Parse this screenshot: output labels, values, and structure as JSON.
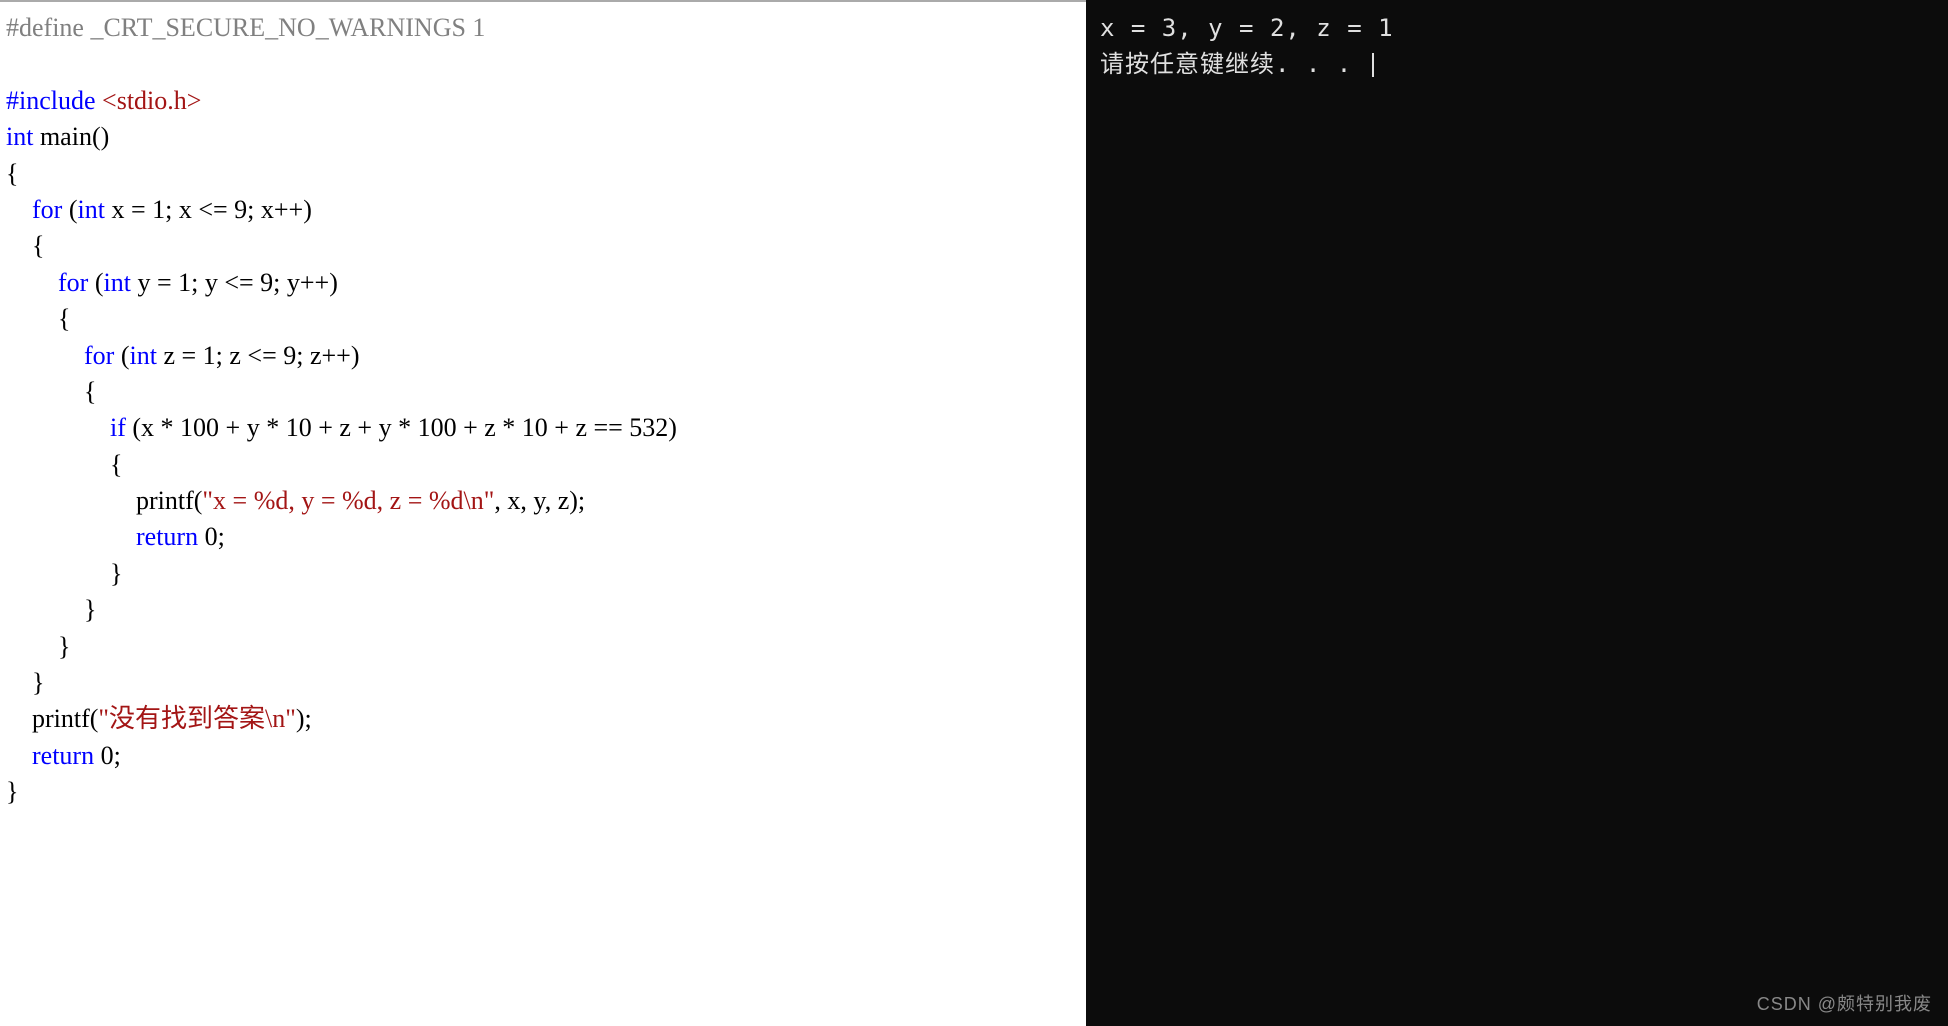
{
  "code": {
    "line1_define": "#define",
    "line1_macro": " _CRT_SECURE_NO_WARNINGS 1",
    "line3_include": "#include",
    "line3_header": " <stdio.h>",
    "line4_type": "int",
    "line4_main": " main()",
    "line5_brace": "{",
    "line6_indent": "    ",
    "line6_for": "for",
    "line6_rest1": " (",
    "line6_int": "int",
    "line6_rest2": " x = 1; x <= 9; x++)",
    "line7": "    {",
    "line8_indent": "        ",
    "line8_for": "for",
    "line8_rest1": " (",
    "line8_int": "int",
    "line8_rest2": " y = 1; y <= 9; y++)",
    "line9": "        {",
    "line10_indent": "            ",
    "line10_for": "for",
    "line10_rest1": " (",
    "line10_int": "int",
    "line10_rest2": " z = 1; z <= 9; z++)",
    "line11": "            {",
    "line12_indent": "                ",
    "line12_if": "if",
    "line12_rest": " (x * 100 + y * 10 + z + y * 100 + z * 10 + z == 532)",
    "line13": "                {",
    "line14_indent": "                    printf(",
    "line14_str": "\"x = %d, y = %d, z = %d\\n\"",
    "line14_rest": ", x, y, z);",
    "line15_indent": "                    ",
    "line15_return": "return",
    "line15_rest": " 0;",
    "line16": "                }",
    "line17": "            }",
    "line18": "        }",
    "line19": "    }",
    "line20_indent": "    printf(",
    "line20_str": "\"没有找到答案\\n\"",
    "line20_rest": ");",
    "line21_indent": "    ",
    "line21_return": "return",
    "line21_rest": " 0;",
    "line22": "}"
  },
  "console": {
    "line1": "x = 3, y = 2, z = 1",
    "line2": "请按任意键继续. . . "
  },
  "watermark": "CSDN @颇特别我废"
}
